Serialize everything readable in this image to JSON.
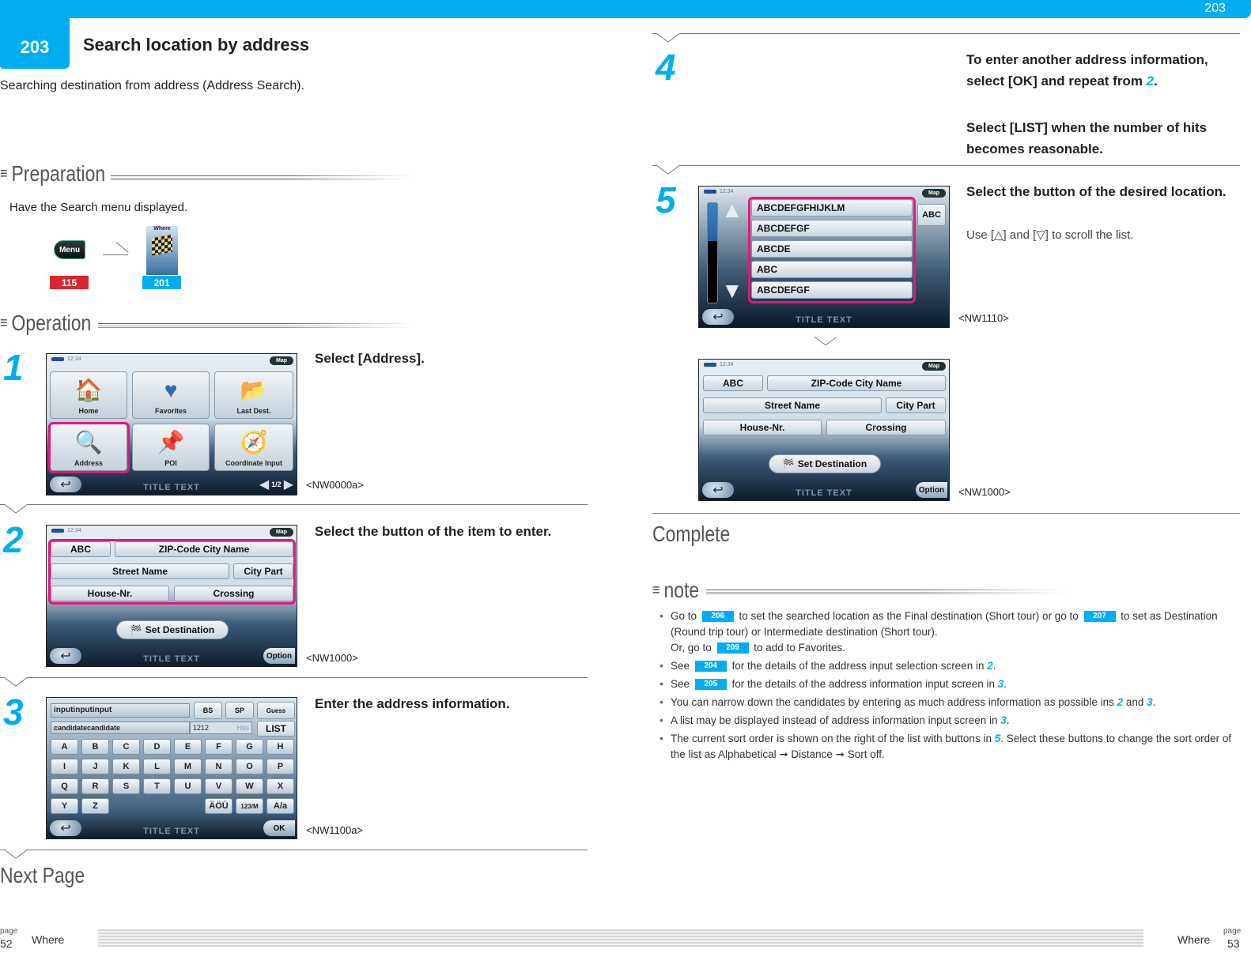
{
  "header": {
    "chapter_number": "203",
    "chapter_title": "Search location by address",
    "right_chapter_number": "203",
    "intro": "Searching destination from address (Address Search)."
  },
  "preparation": {
    "heading": "Preparation",
    "text": "Have the Search menu displayed.",
    "menu_button_label": "Menu",
    "where_image_label": "Where",
    "badges": [
      "115",
      "201"
    ],
    "colors": {
      "red": "#d7282f",
      "blue": "#00aeef"
    }
  },
  "operation": {
    "heading": "Operation"
  },
  "steps": [
    {
      "number": "1",
      "title": "Select [Address].",
      "caption": "<NW0000a>",
      "screen": {
        "time": "12:34",
        "map_label": "Map",
        "tiles": [
          "Home",
          "Favorites",
          "Last Dest.",
          "Address",
          "POI",
          "Coordinate Input"
        ],
        "title_text": "TITLE TEXT",
        "page_indicator": "1/2"
      }
    },
    {
      "number": "2",
      "title": "Select the button of the item to enter.",
      "caption": "<NW1000>",
      "screen": {
        "time": "12:34",
        "map_label": "Map",
        "buttons": [
          "ABC",
          "ZIP-Code City Name",
          "Street Name",
          "City Part",
          "House-Nr.",
          "Crossing"
        ],
        "set_destination": "Set Destination",
        "title_text": "TITLE TEXT",
        "option_label": "Option"
      }
    },
    {
      "number": "3",
      "title": "Enter the address information.",
      "caption": "<NW1100a>",
      "screen": {
        "input_value": "inputinputinput",
        "candidate_value": "candidatecandidate",
        "hits_count": "1212",
        "hits_label": "Hits",
        "bs_label": "BS",
        "sp_label": "SP",
        "guess_label": "Guess",
        "list_label": "LIST",
        "keys_row1": [
          "A",
          "B",
          "C",
          "D",
          "E",
          "F",
          "G",
          "H"
        ],
        "keys_row2": [
          "I",
          "J",
          "K",
          "L",
          "M",
          "N",
          "O",
          "P"
        ],
        "keys_row3": [
          "Q",
          "R",
          "S",
          "T",
          "U",
          "V",
          "W",
          "X"
        ],
        "keys_row4": [
          "Y",
          "Z"
        ],
        "umlaut_key": "ÄÖÜ",
        "num_key": "123/M",
        "case_key": "A/a",
        "title_text": "TITLE TEXT",
        "ok_label": "OK"
      }
    },
    {
      "number": "4",
      "title_line1_prefix": "To enter another address information, select [OK] and repeat from ",
      "title_line1_ref": "2",
      "title_line1_suffix": ".",
      "title_line2": "Select [LIST] when the number of hits becomes reasonable."
    },
    {
      "number": "5",
      "title": "Select the button of the desired location.",
      "subtitle": "Use [△] and [▽] to scroll the list.",
      "caption_a": "<NW1110>",
      "caption_b": "<NW1000>",
      "screen_a": {
        "time": "12:34",
        "map_label": "Map",
        "list_items": [
          "ABCDEFGFHIJKLM",
          "ABCDEFGF",
          "ABCDE",
          "ABC",
          "ABCDEFGF"
        ],
        "sort_label": "ABC",
        "title_text": "TITLE TEXT"
      },
      "screen_b": {
        "time": "12:34",
        "map_label": "Map",
        "buttons": [
          "ABC",
          "ZIP-Code City Name",
          "Street Name",
          "City Part",
          "House-Nr.",
          "Crossing"
        ],
        "set_destination": "Set Destination",
        "title_text": "TITLE TEXT",
        "option_label": "Option"
      }
    }
  ],
  "next_page": "Next Page",
  "complete": "Complete",
  "note": {
    "heading": "note",
    "items": [
      {
        "parts": [
          "Go to ",
          "206",
          " to set the searched location as the Final destination (Short tour) or go to ",
          "207",
          " to set as Destination (Round trip tour) or Intermediate destination (Short tour).",
          "Or, go to ",
          "209",
          " to add to Favorites."
        ]
      },
      {
        "a": "See ",
        "ref": "204",
        "b": " for the details of the address input selection screen in ",
        "step": "2",
        "c": "."
      },
      {
        "a": "See ",
        "ref": "205",
        "b": " for the details of the address information input screen in ",
        "step": "3",
        "c": "."
      },
      {
        "a": "You can narrow down the candidates by entering as much address information as possible ins ",
        "step": "2",
        "b": " and ",
        "step2": "3",
        "c": "."
      },
      {
        "a": "A list may be displayed instead of address information input screen in ",
        "step": "3",
        "c": "."
      },
      {
        "a": "The current sort order is shown on the right of the list with buttons in ",
        "step": "5",
        "b": ". Select these buttons to change the sort order of the list as Alphabetical ➞ Distance ➞ Sort off."
      }
    ]
  },
  "footer": {
    "left": {
      "page_label": "page",
      "page_number": "52",
      "section": "Where"
    },
    "right": {
      "page_label": "page",
      "page_number": "53",
      "section": "Where"
    }
  }
}
